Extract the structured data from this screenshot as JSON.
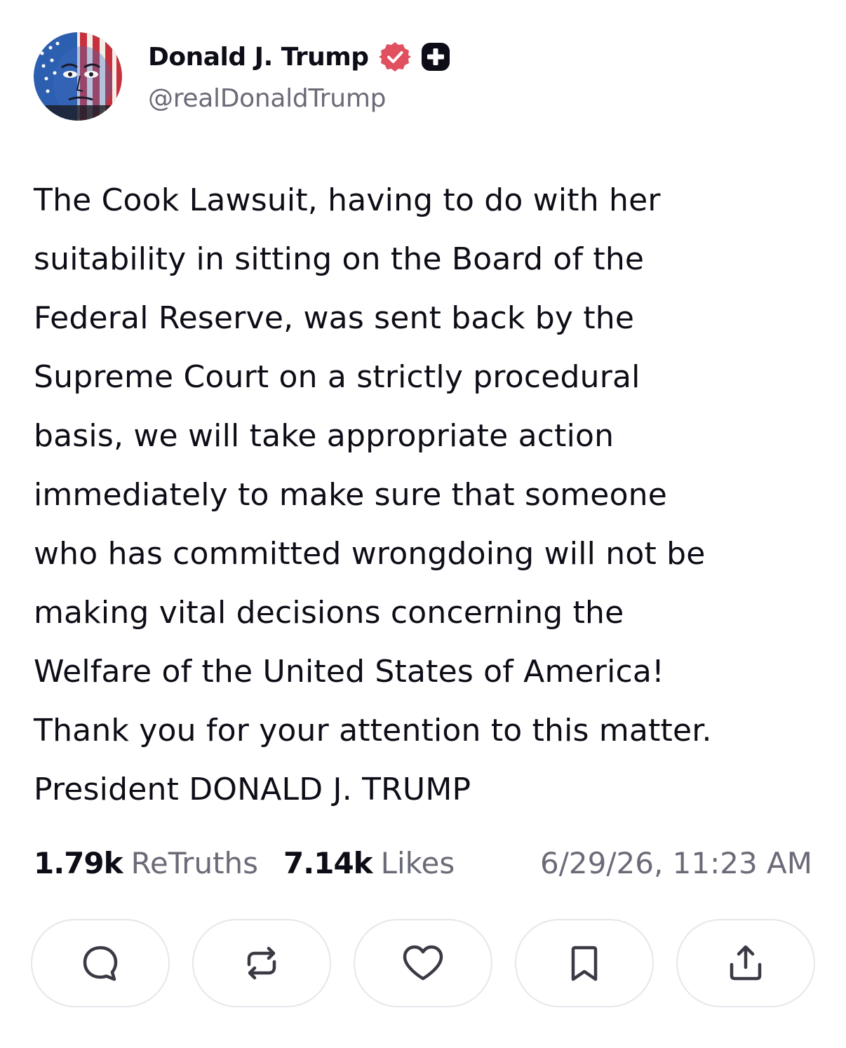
{
  "author": {
    "display_name": "Donald J. Trump",
    "handle": "@realDonaldTrump",
    "verified_icon": "verified-badge-icon",
    "verified_color": "#e0505e",
    "plus_icon": "truth-plus-icon",
    "avatar": "flag-painted-portrait-avatar"
  },
  "post": {
    "lines": [
      "The Cook Lawsuit, having to do with her",
      "suitability in sitting on the Board of the",
      "Federal Reserve, was sent back by the",
      "Supreme Court on a strictly procedural",
      "basis, we will take appropriate action",
      "immediately to make sure that someone",
      "who has committed wrongdoing will not be",
      "making vital decisions concerning the",
      "Welfare of the United States of America!",
      "Thank you for your attention to this matter.",
      "President DONALD J. TRUMP"
    ]
  },
  "stats": {
    "retruths_count": "1.79k",
    "retruths_label": "ReTruths",
    "likes_count": "7.14k",
    "likes_label": "Likes",
    "timestamp": "6/29/26, 11:23 AM"
  },
  "actions": [
    {
      "icon": "reply-icon"
    },
    {
      "icon": "retruth-icon"
    },
    {
      "icon": "like-heart-icon"
    },
    {
      "icon": "bookmark-icon"
    },
    {
      "icon": "share-icon"
    }
  ],
  "colors": {
    "text": "#0d0d17",
    "muted": "#6b6b78",
    "button_border": "#e6e6ec",
    "icon": "#3a3a44"
  }
}
